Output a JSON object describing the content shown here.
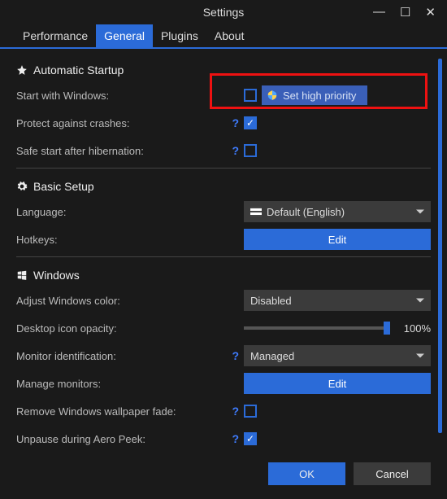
{
  "window": {
    "title": "Settings",
    "minimize": "—",
    "maximize": "☐",
    "close": "✕"
  },
  "tabs": {
    "performance": "Performance",
    "general": "General",
    "plugins": "Plugins",
    "about": "About"
  },
  "sections": {
    "startup": {
      "title": "Automatic Startup",
      "start_with_windows": "Start with Windows:",
      "set_high_priority": "Set high priority",
      "protect_crashes": "Protect against crashes:",
      "safe_start": "Safe start after hibernation:"
    },
    "basic": {
      "title": "Basic Setup",
      "language": "Language:",
      "language_value": "Default (English)",
      "hotkeys": "Hotkeys:",
      "edit": "Edit"
    },
    "windows": {
      "title": "Windows",
      "adjust_color": "Adjust Windows color:",
      "adjust_color_value": "Disabled",
      "icon_opacity": "Desktop icon opacity:",
      "icon_opacity_value": "100%",
      "monitor_id": "Monitor identification:",
      "monitor_id_value": "Managed",
      "manage_monitors": "Manage monitors:",
      "edit": "Edit",
      "remove_fade": "Remove Windows wallpaper fade:",
      "unpause_peek": "Unpause during Aero Peek:"
    }
  },
  "help_symbol": "?",
  "footer": {
    "ok": "OK",
    "cancel": "Cancel"
  }
}
